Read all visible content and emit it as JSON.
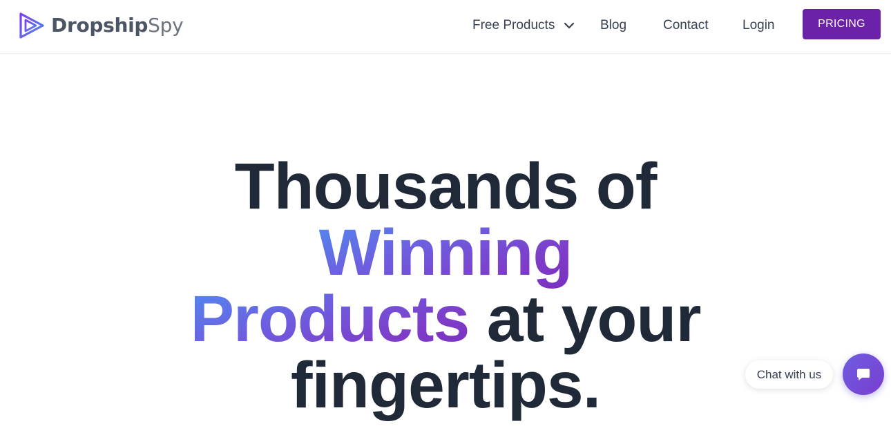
{
  "brand": {
    "name_bold": "Dropship",
    "name_light": "Spy",
    "logo_icon": "play-triangle-icon",
    "accent_color": "#6b21a8"
  },
  "nav": {
    "free_products": "Free Products",
    "blog": "Blog",
    "contact": "Contact",
    "login": "Login",
    "pricing": "PRICING"
  },
  "hero": {
    "line1": "Thousands of",
    "line2": "Winning",
    "line3_gradient": "Products",
    "line3_rest": " at your",
    "line4": "fingertips.",
    "gradient_from": "#4f8cf0",
    "gradient_to": "#7a2fbf"
  },
  "chat": {
    "label": "Chat with us",
    "icon": "chat-bubble-icon"
  }
}
